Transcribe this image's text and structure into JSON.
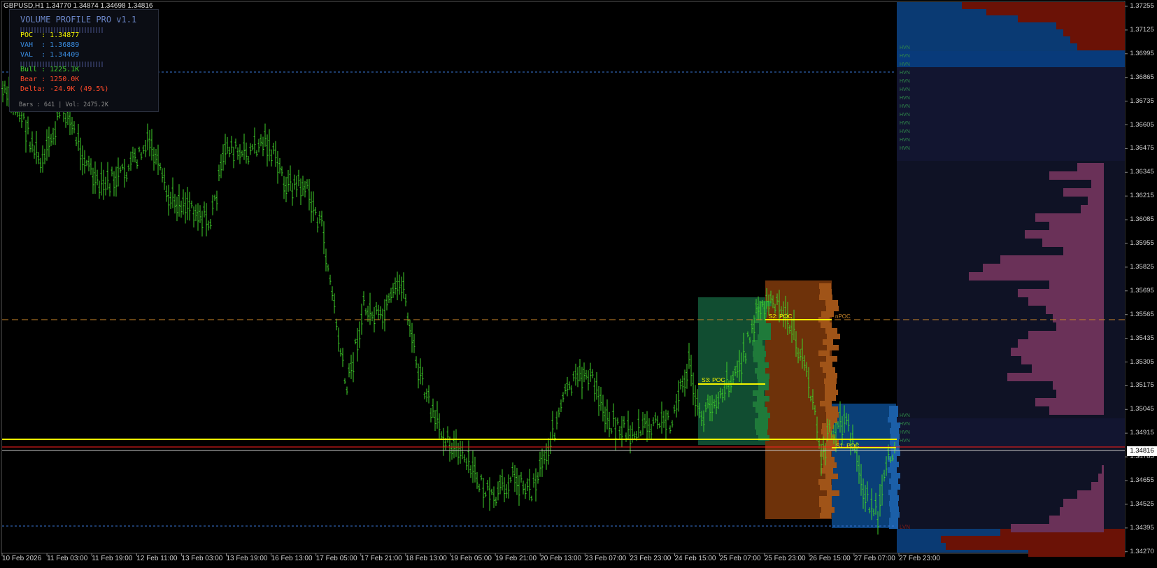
{
  "chart": {
    "symbol_info": "GBPUSD,H1  1.34770 1.34874 1.34698 1.34816",
    "colors": {
      "background": "#000000",
      "candles": "#3fd12a",
      "poc": "#f5f500",
      "vah_val": "#3a77d8",
      "npoc": "#c8852a",
      "current_price": "#ff2020",
      "bid_line": "#c8c8c8"
    },
    "price_labels": [
      "1.37255",
      "1.37125",
      "1.36995",
      "1.36865",
      "1.36735",
      "1.36605",
      "1.36475",
      "1.36345",
      "1.36215",
      "1.36085",
      "1.35955",
      "1.35825",
      "1.35695",
      "1.35565",
      "1.35435",
      "1.35305",
      "1.35175",
      "1.35045",
      "1.34915",
      "1.34785",
      "1.34655",
      "1.34525",
      "1.34395",
      "1.34270"
    ],
    "current_price": "1.34816",
    "time_labels": [
      "10 Feb 2026",
      "11 Feb 03:00",
      "11 Feb 19:00",
      "12 Feb 11:00",
      "13 Feb 03:00",
      "13 Feb 19:00",
      "16 Feb 13:00",
      "17 Feb 05:00",
      "17 Feb 21:00",
      "18 Feb 13:00",
      "19 Feb 05:00",
      "19 Feb 21:00",
      "20 Feb 13:00",
      "23 Feb 07:00",
      "23 Feb 23:00",
      "24 Feb 15:00",
      "25 Feb 07:00",
      "25 Feb 23:00",
      "26 Feb 15:00",
      "27 Feb 07:00",
      "27 Feb 23:00"
    ]
  },
  "panel": {
    "title": "VOLUME PROFILE PRO v1.1",
    "poc": "POC  : 1.34877",
    "vah": "VAH  : 1.36889",
    "val": "VAL  : 1.34409",
    "bull": "Bull : 1225.1K",
    "bear": "Bear : 1250.0K",
    "delta": "Delta: -24.9K (49.5%)",
    "footer": "Bars : 641 | Vol: 2475.2K",
    "colors": {
      "poc": "#f5f500",
      "vah": "#3a8ce0",
      "val": "#3a8ce0",
      "bull": "#3fd12a",
      "bear": "#ff4a2a",
      "delta": "#ff4a2a"
    }
  },
  "sessions": {
    "s3": "S3: POC",
    "s2": "S2: POC",
    "s1": "S1: POC",
    "npoc": "nPOC"
  },
  "profile": {
    "hvn_label": "HVN",
    "lvn_label": "LVN",
    "colors": {
      "value_area": "#121530",
      "outside": "#0f1225",
      "bull_bar": "#6a3158",
      "bear_bar": "#6b1206",
      "vah_zone": "#0a3a73"
    }
  }
}
